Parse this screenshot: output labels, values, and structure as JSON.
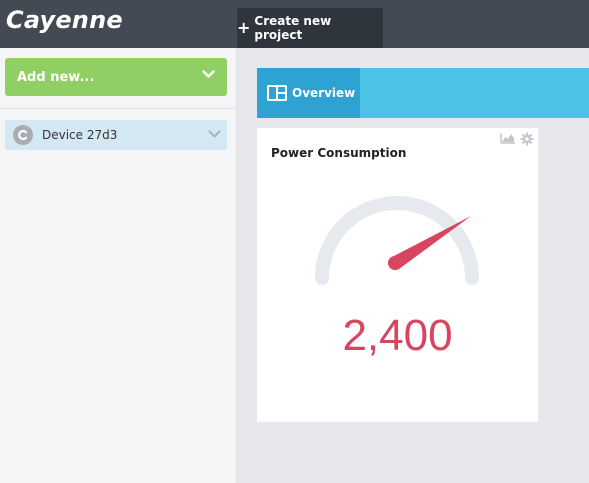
{
  "app": {
    "logo_text": "Cayenne"
  },
  "header": {
    "create_project_label": "Create new project"
  },
  "sidebar": {
    "add_new_label": "Add new...",
    "devices": [
      {
        "name": "Device 27d3"
      }
    ]
  },
  "tabs": [
    {
      "label": "Overview",
      "active": true
    }
  ],
  "widgets": [
    {
      "title": "Power Consumption",
      "type": "gauge",
      "value_text": "2,400",
      "value_color": "#d94460",
      "icons": [
        "chart-icon",
        "gear-icon"
      ]
    }
  ],
  "colors": {
    "topbar": "#434a54",
    "add_new": "#8fcf63",
    "tabbar": "#4bc2e6",
    "tab_active": "#2ea2d2",
    "device_selected": "#d3e8f3",
    "gauge_needle": "#d94460"
  }
}
